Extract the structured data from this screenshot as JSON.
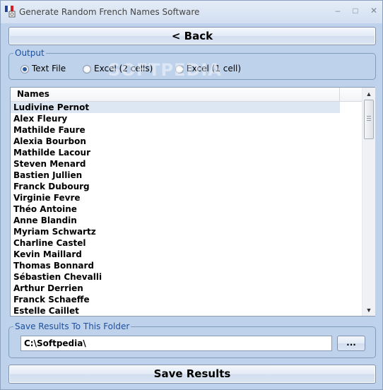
{
  "window": {
    "title": "Generate Random French Names Software",
    "minimize": "–",
    "maximize": "□",
    "close": "✕"
  },
  "toolbar": {
    "back_label": "< Back",
    "save_label": "Save Results"
  },
  "output": {
    "legend": "Output",
    "options": [
      "Text File",
      "Excel (2 cells)",
      "Excel (1 cell)"
    ],
    "selected": "Text File"
  },
  "watermark": "SOFTPEDIA",
  "list": {
    "column_header": "Names",
    "selected_index": 0,
    "rows": [
      "Ludivine Pernot",
      "Alex Fleury",
      "Mathilde Faure",
      "Alexia Bourbon",
      "Mathilde Lacour",
      "Steven Menard",
      "Bastien Jullien",
      "Franck Dubourg",
      "Virginie Fevre",
      "Théo Antoine",
      "Anne Blandin",
      "Myriam Schwartz",
      "Charline Castel",
      "Kevin Maillard",
      "Thomas Bonnard",
      "Sébastien Chevalli",
      "Arthur Derrien",
      "Franck Schaeffe",
      "Estelle Caillet"
    ],
    "scroll_up": "▲",
    "scroll_down": "▼"
  },
  "folder": {
    "legend": "Save Results To This Folder",
    "path": "C:\\Softpedia\\",
    "browse_label": "..."
  },
  "colors": {
    "window_bg": "#bfd2eb",
    "legend_text": "#1e4f9c",
    "selected_row": "#dde6f3"
  }
}
